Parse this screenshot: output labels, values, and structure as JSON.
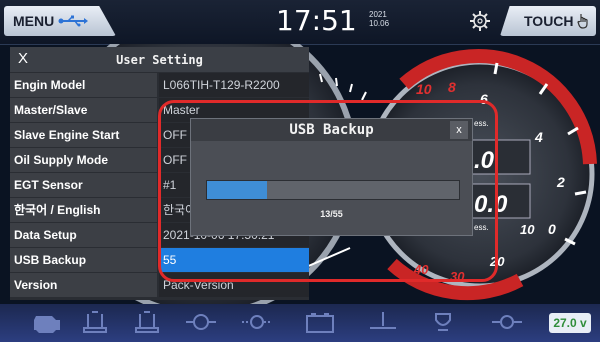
{
  "topbar": {
    "menu_label": "MENU",
    "time": "17:51",
    "date_year": "2021",
    "date_day": "10.06",
    "touch_label": "TOUCH"
  },
  "panel": {
    "close_label": "X",
    "title": "User Setting",
    "rows": [
      {
        "key": "Engin Model",
        "value": "L066TIH-T129-R2200"
      },
      {
        "key": "Master/Slave",
        "value": "Master"
      },
      {
        "key": "Slave Engine Start",
        "value": "OFF"
      },
      {
        "key": "Oil Supply Mode",
        "value": "OFF"
      },
      {
        "key": "EGT Sensor",
        "value": "#1"
      },
      {
        "key": "한국어 / English",
        "value": "한국어"
      },
      {
        "key": "Data Setup",
        "value": "2021-10-06 17:50:21"
      },
      {
        "key": "USB Backup",
        "value": "55"
      },
      {
        "key": "Version",
        "value": "Pack-Version"
      }
    ]
  },
  "dialog": {
    "title": "USB Backup",
    "close_label": "x",
    "progress_current": 13,
    "progress_total": 55,
    "progress_text": "13/55"
  },
  "gauges": {
    "right_scale": [
      "0",
      "2",
      "4",
      "6",
      "8",
      "10"
    ],
    "left_scale": [
      "10",
      "20",
      "30",
      "40"
    ],
    "readouts": [
      ".0",
      "0.0"
    ],
    "unit_label": "ess."
  },
  "status": {
    "voltage": "27.0 v"
  },
  "colors": {
    "accent_blue": "#1f7ee0",
    "frame_red": "#e02a2a",
    "voltage_green": "#2f8d3a"
  },
  "icons": [
    "usb-icon",
    "settings-gear-icon",
    "touch-hand-icon",
    "engine-icon",
    "oil-can-icon",
    "oil-can-icon",
    "coolant-icon",
    "engine-check-icon",
    "battery-icon",
    "water-level-icon",
    "filter-icon",
    "temperature-icon"
  ]
}
